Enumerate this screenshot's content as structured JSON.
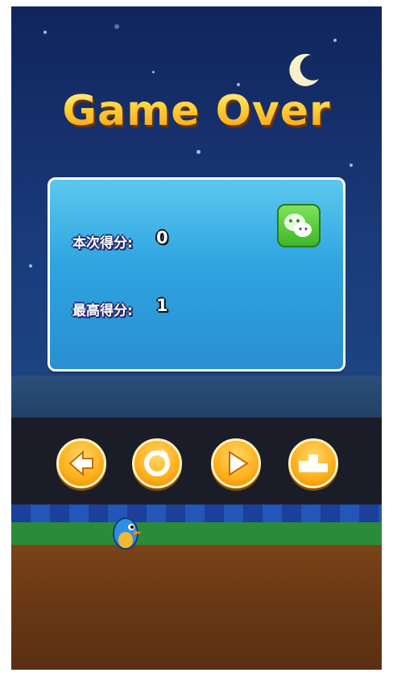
{
  "screen": {
    "title": "Game Over"
  },
  "score_panel": {
    "current_score_label": "本次得分:",
    "current_score_value": "0",
    "best_score_label": "最高得分:",
    "best_score_value": "1",
    "share_icon": "wechat-icon"
  },
  "buttons": [
    {
      "icon": "back-arrow-icon"
    },
    {
      "icon": "restart-icon"
    },
    {
      "icon": "play-icon"
    },
    {
      "icon": "leaderboard-podium-icon"
    }
  ],
  "colors": {
    "title_gold": "#ffc21c",
    "panel_blue": "#2ea4e0",
    "button_orange": "#ffae1a",
    "night_sky": "#10255c"
  }
}
